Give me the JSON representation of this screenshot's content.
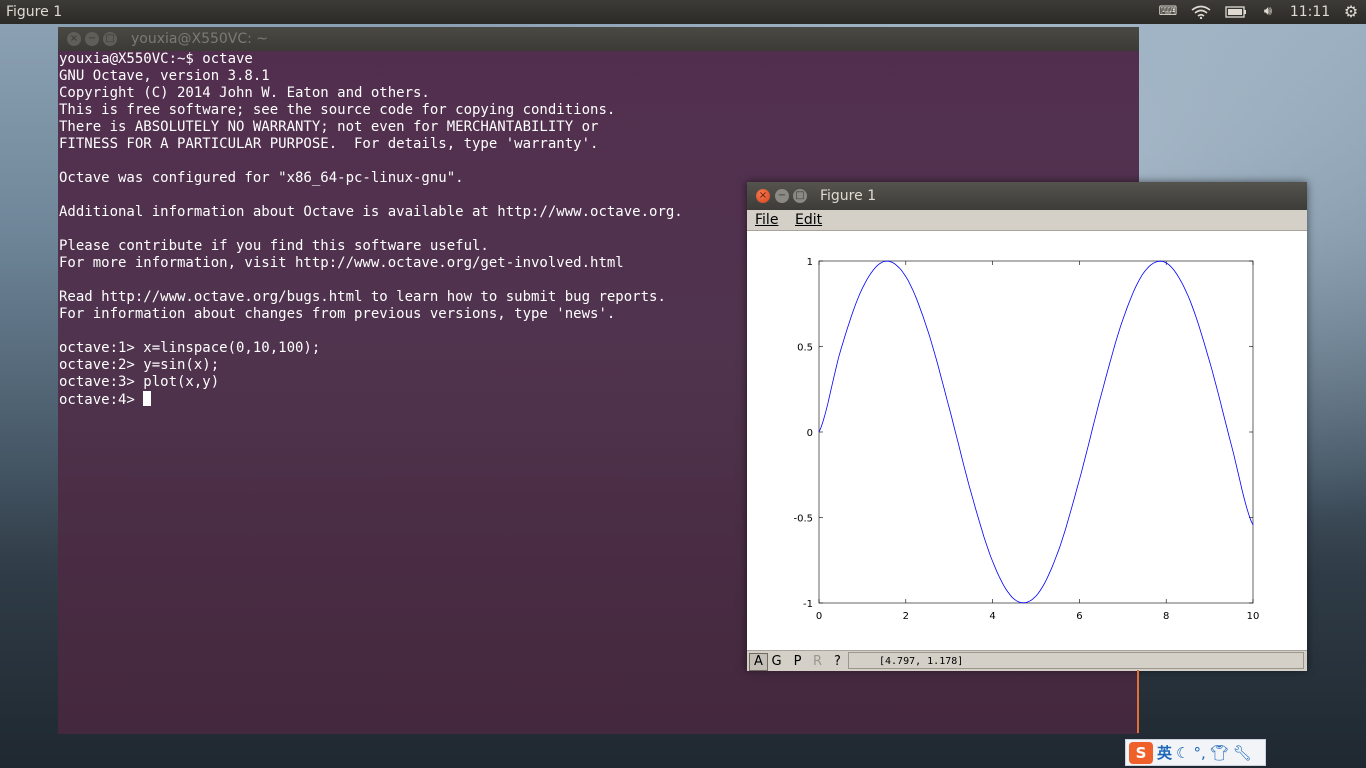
{
  "top_panel": {
    "title": "Figure 1",
    "clock": "11:11",
    "icons": [
      "keyboard-icon",
      "wifi-icon",
      "battery-icon",
      "volume-icon",
      "gear-icon"
    ]
  },
  "terminal": {
    "title": "youxia@X550VC: ~",
    "lines": [
      "youxia@X550VC:~$ octave",
      "GNU Octave, version 3.8.1",
      "Copyright (C) 2014 John W. Eaton and others.",
      "This is free software; see the source code for copying conditions.",
      "There is ABSOLUTELY NO WARRANTY; not even for MERCHANTABILITY or",
      "FITNESS FOR A PARTICULAR PURPOSE.  For details, type 'warranty'.",
      "",
      "Octave was configured for \"x86_64-pc-linux-gnu\".",
      "",
      "Additional information about Octave is available at http://www.octave.org.",
      "",
      "Please contribute if you find this software useful.",
      "For more information, visit http://www.octave.org/get-involved.html",
      "",
      "Read http://www.octave.org/bugs.html to learn how to submit bug reports.",
      "For information about changes from previous versions, type 'news'.",
      "",
      "octave:1> x=linspace(0,10,100);",
      "octave:2> y=sin(x);",
      "octave:3> plot(x,y)"
    ],
    "prompt": "octave:4> "
  },
  "figure": {
    "title": "Figure 1",
    "menu": {
      "file": "File",
      "edit": "Edit"
    },
    "toolbar": {
      "a": "A",
      "g": "G",
      "p": "P",
      "r": "R",
      "help": "?"
    },
    "coords": "[4.797, 1.178]"
  },
  "chart_data": {
    "type": "line",
    "x": [
      0,
      0.5,
      1,
      1.5,
      2,
      2.5,
      3,
      3.5,
      4,
      4.5,
      5,
      5.5,
      6,
      6.5,
      7,
      7.5,
      8,
      8.5,
      9,
      9.5,
      10
    ],
    "series": [
      {
        "values": [
          0,
          0.479,
          0.841,
          0.997,
          0.909,
          0.598,
          0.141,
          -0.351,
          -0.757,
          -0.978,
          -0.959,
          -0.706,
          -0.279,
          0.215,
          0.657,
          0.938,
          0.989,
          0.798,
          0.412,
          -0.075,
          -0.544
        ],
        "color": "#0000ff"
      }
    ],
    "xlim": [
      0,
      10
    ],
    "ylim": [
      -1,
      1
    ],
    "xticks": [
      "0",
      "2",
      "4",
      "6",
      "8",
      "10"
    ],
    "yticks": [
      "1",
      "0.5",
      "0",
      "-0.5",
      "-1"
    ],
    "grid": false
  },
  "ime": {
    "logo": "S",
    "lang": "英",
    "icons": [
      "moon-icon",
      "punctuation-icon",
      "shirt-icon",
      "wrench-icon"
    ]
  }
}
